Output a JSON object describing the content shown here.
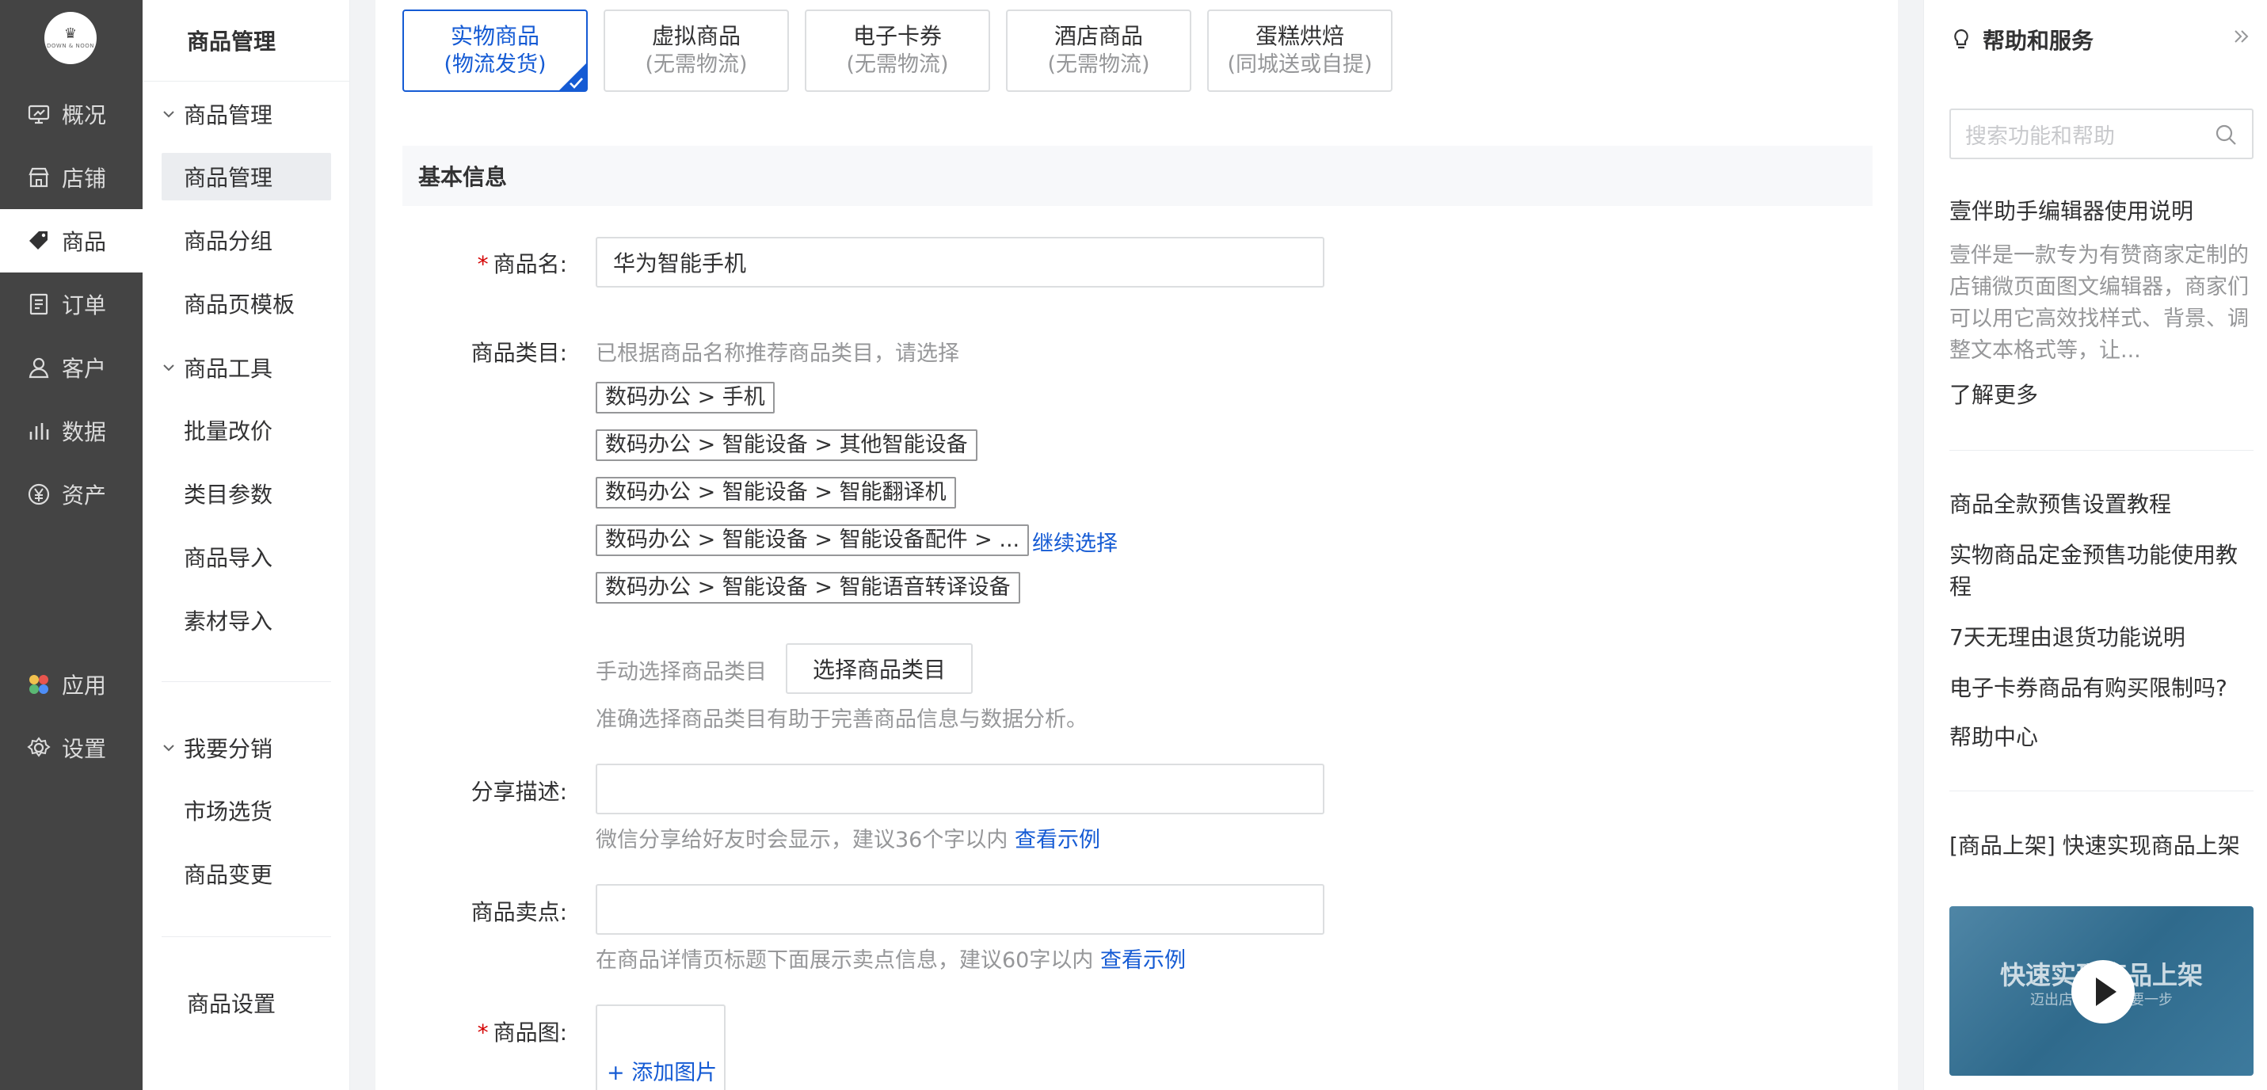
{
  "nav": {
    "logo_text": "DOWN & NOON",
    "items": [
      {
        "label": "概况",
        "icon": "monitor-icon"
      },
      {
        "label": "店铺",
        "icon": "store-icon"
      },
      {
        "label": "商品",
        "icon": "tag-icon",
        "active": true
      },
      {
        "label": "订单",
        "icon": "order-icon"
      },
      {
        "label": "客户",
        "icon": "user-icon"
      },
      {
        "label": "数据",
        "icon": "bar-chart-icon"
      },
      {
        "label": "资产",
        "icon": "yen-icon"
      },
      {
        "label": "应用",
        "icon": "apps-icon"
      },
      {
        "label": "设置",
        "icon": "gear-icon"
      }
    ]
  },
  "subnav": {
    "title": "商品管理",
    "groups": [
      {
        "label": "商品管理",
        "items": [
          "商品管理",
          "商品分组",
          "商品页模板"
        ]
      },
      {
        "label": "商品工具",
        "items": [
          "批量改价",
          "类目参数",
          "商品导入",
          "素材导入"
        ]
      },
      {
        "label": "我要分销",
        "items": [
          "市场选货",
          "商品变更"
        ]
      }
    ],
    "settings": "商品设置"
  },
  "types": [
    {
      "title": "实物商品",
      "sub": "(物流发货)",
      "active": true
    },
    {
      "title": "虚拟商品",
      "sub": "(无需物流)"
    },
    {
      "title": "电子卡券",
      "sub": "(无需物流)"
    },
    {
      "title": "酒店商品",
      "sub": "(无需物流)"
    },
    {
      "title": "蛋糕烘焙",
      "sub": "(同城送或自提)"
    }
  ],
  "section_title": "基本信息",
  "form": {
    "name_label": "商品名:",
    "name_value": "华为智能手机",
    "category_label": "商品类目:",
    "category_hint": "已根据商品名称推荐商品类目，请选择",
    "category_tags": [
      "数码办公 > 手机",
      "数码办公 > 智能设备 > 其他智能设备",
      "数码办公 > 智能设备 > 智能翻译机",
      "数码办公 > 智能设备 > 智能设备配件 > ...",
      "数码办公 > 智能设备 > 智能语音转译设备"
    ],
    "continue_select": "继续选择",
    "manual_label": "手动选择商品类目",
    "select_button": "选择商品类目",
    "category_note": "准确选择商品类目有助于完善商品信息与数据分析。",
    "share_label": "分享描述:",
    "share_hint": "微信分享给好友时会显示，建议36个字以内",
    "share_example": "查看示例",
    "selling_label": "商品卖点:",
    "selling_hint": "在商品详情页标题下面展示卖点信息，建议60字以内",
    "selling_example": "查看示例",
    "image_label": "商品图:",
    "add_image": "+ 添加图片"
  },
  "help": {
    "title": "帮助和服务",
    "search_placeholder": "搜索功能和帮助",
    "article_title": "壹伴助手编辑器使用说明",
    "article_desc": "壹伴是一款专为有赞商家定制的店铺微页面图文编辑器，商家们可以用它高效找样式、背景、调整文本格式等，让...",
    "learn_more": "了解更多",
    "links": [
      "商品全款预售设置教程",
      "实物商品定金预售功能使用教程",
      "7天无理由退货功能说明",
      "电子卡券商品有购买限制吗?"
    ],
    "help_center": "帮助中心",
    "video_caption": "[商品上架]   快速实现商品上架",
    "video_title": "快速实现商品上架",
    "video_sub": "迈出店铺经营重要一步"
  }
}
